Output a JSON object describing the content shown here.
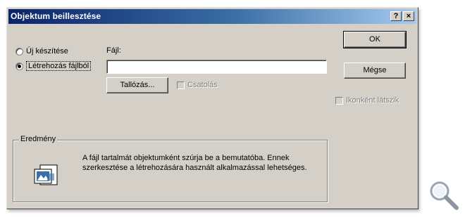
{
  "dialog": {
    "title": "Objektum beillesztése",
    "help_label": "?",
    "close_label": "×"
  },
  "options": {
    "new_label": "Új készítése",
    "from_file_label": "Létrehozás fájlból",
    "selected": "from_file"
  },
  "file": {
    "label": "Fájl:",
    "value": ""
  },
  "buttons": {
    "ok": "OK",
    "cancel": "Mégse",
    "browse": "Tallózás..."
  },
  "checkboxes": {
    "link_label": "Csatolás",
    "icon_label": "Ikonként látszik"
  },
  "result": {
    "legend": "Eredmény",
    "text": "A fájl tartalmát objektumként szúrja be a bemutatóba. Ennek szerkesztése a létrehozására használt alkalmazással lehetséges."
  },
  "colors": {
    "title_start": "#0a246a",
    "title_end": "#a6caf0",
    "face": "#d4d0c8"
  },
  "icons": {
    "help": "question-mark",
    "close": "x",
    "result": "document-with-picture",
    "magnifier": "zoom"
  }
}
